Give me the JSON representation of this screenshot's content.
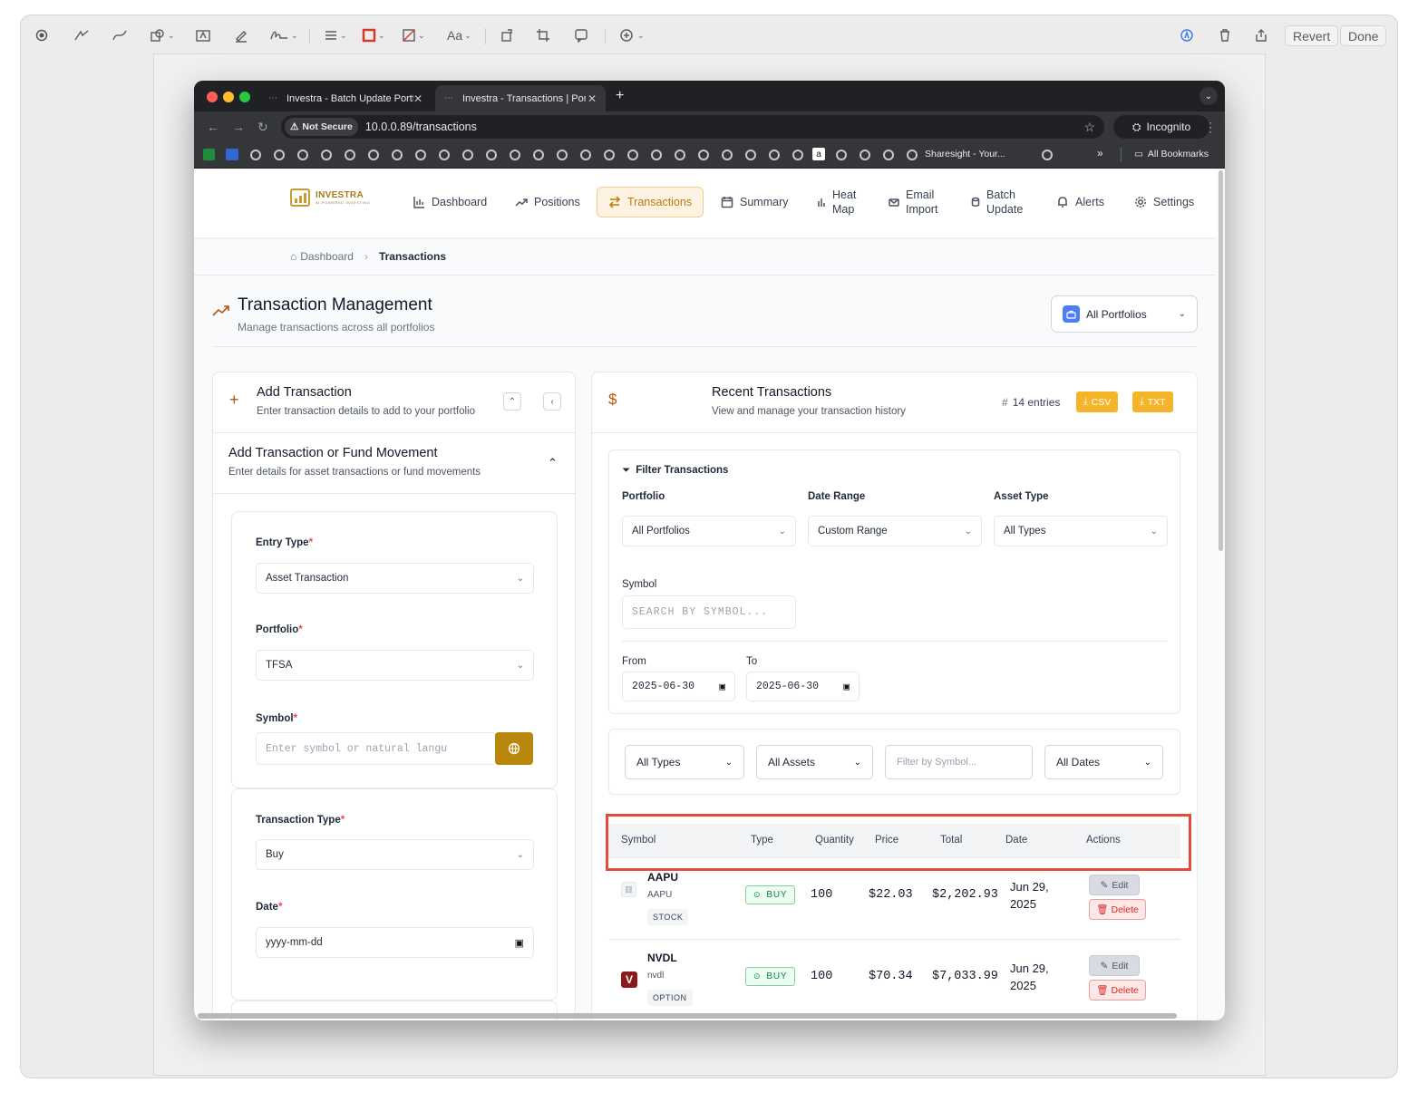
{
  "preview_toolbar": {
    "revert_label": "Revert",
    "done_label": "Done",
    "text_style_label": "Aa"
  },
  "browser": {
    "tabs": [
      {
        "title": "Investra - Batch Update Portf"
      },
      {
        "title": "Investra - Transactions | Portf"
      }
    ],
    "not_secure_label": "Not Secure",
    "url": "10.0.0.89/transactions",
    "incognito_label": "Incognito",
    "bookmark_sharesight": "Sharesight - Your...",
    "all_bookmarks_label": "All Bookmarks"
  },
  "app": {
    "brand": "INVESTRA",
    "tagline": "AI-POWERED INVESTING",
    "nav": [
      {
        "label": "Dashboard"
      },
      {
        "label": "Positions"
      },
      {
        "label": "Transactions"
      },
      {
        "label": "Summary"
      },
      {
        "label": "Heat",
        "label2": "Map"
      },
      {
        "label": "Email",
        "label2": "Import"
      },
      {
        "label": "Batch",
        "label2": "Update"
      },
      {
        "label": "Alerts"
      },
      {
        "label": "Settings"
      }
    ],
    "breadcrumb": {
      "home": "Dashboard",
      "current": "Transactions"
    }
  },
  "page": {
    "title": "Transaction Management",
    "subtitle": "Manage transactions across all portfolios",
    "portfolio_selector": "All Portfolios"
  },
  "add_panel": {
    "title": "Add Transaction",
    "subtitle": "Enter transaction details to add to your portfolio",
    "section_title": "Add Transaction or Fund Movement",
    "section_subtitle": "Enter details for asset transactions or fund movements",
    "entry_type_label": "Entry Type",
    "entry_type_value": "Asset Transaction",
    "portfolio_label": "Portfolio",
    "portfolio_value": "TFSA",
    "symbol_label": "Symbol",
    "symbol_placeholder": "Enter symbol or natural langu",
    "transaction_type_label": "Transaction Type",
    "transaction_type_value": "Buy",
    "date_label": "Date",
    "date_placeholder": "yyyy-mm-dd",
    "required_mark": "*"
  },
  "recent": {
    "title": "Recent Transactions",
    "subtitle": "View and manage your transaction history",
    "entries": "14 entries",
    "csv_label": "CSV",
    "txt_label": "TXT",
    "filter_title": "Filter Transactions",
    "portfolio_label": "Portfolio",
    "portfolio_value": "All Portfolios",
    "date_range_label": "Date Range",
    "date_range_value": "Custom Range",
    "asset_type_label": "Asset Type",
    "asset_type_value": "All Types",
    "symbol_label": "Symbol",
    "symbol_placeholder": "SEARCH BY SYMBOL...",
    "from_label": "From",
    "from_value": "2025-06-30",
    "to_label": "To",
    "to_value": "2025-06-30",
    "quick_filters": {
      "types": "All Types",
      "assets": "All Assets",
      "symbol_placeholder": "Filter by Symbol...",
      "dates": "All Dates"
    },
    "columns": [
      "Symbol",
      "Type",
      "Quantity",
      "Price",
      "Total",
      "Date",
      "Actions"
    ],
    "rows": [
      {
        "symbol": "AAPU",
        "sub": "AAPU",
        "asset": "STOCK",
        "type": "BUY",
        "quantity": "100",
        "price": "$22.03",
        "total": "$2,202.93",
        "date1": "Jun 29,",
        "date2": "2025",
        "edit": "Edit",
        "delete": "Delete"
      },
      {
        "symbol": "NVDL",
        "sub": "nvdl",
        "asset": "OPTION",
        "type": "BUY",
        "quantity": "100",
        "price": "$70.34",
        "total": "$7,033.99",
        "date1": "Jun 29,",
        "date2": "2025",
        "edit": "Edit",
        "delete": "Delete",
        "logo_letter": "V"
      }
    ]
  },
  "colors": {
    "accent": "#f5b52a",
    "active_nav": "#c2780d",
    "highlight_box": "#e34b3d",
    "buy_green": "#15803d"
  }
}
